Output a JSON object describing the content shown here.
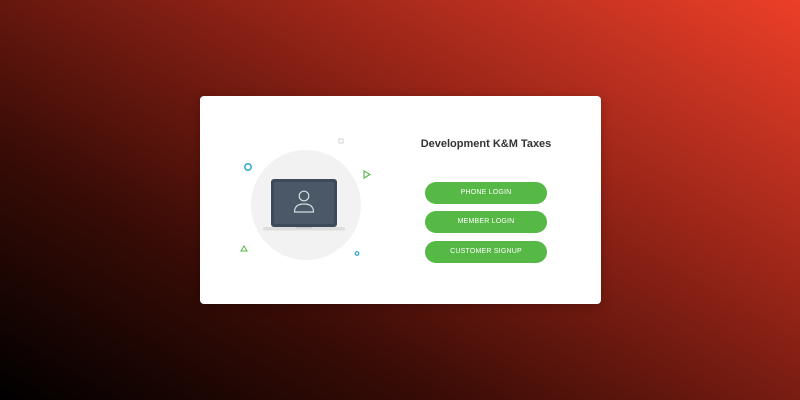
{
  "card": {
    "title": "Development K&M Taxes"
  },
  "buttons": {
    "phone_login": "PHONE LOGIN",
    "member_login": "MEMBER LOGIN",
    "customer_signup": "CUSTOMER SIGNUP"
  },
  "colors": {
    "button_green": "#56b845",
    "title_text": "#333333",
    "screen_dark": "#3d4a5a",
    "accent_blue": "#2aa6c8"
  },
  "icons": {
    "illustration": "laptop-user-icon",
    "decorations": [
      "circle-outline-icon",
      "square-outline-icon",
      "triangle-play-icon",
      "triangle-outline-icon",
      "small-circle-icon"
    ]
  }
}
